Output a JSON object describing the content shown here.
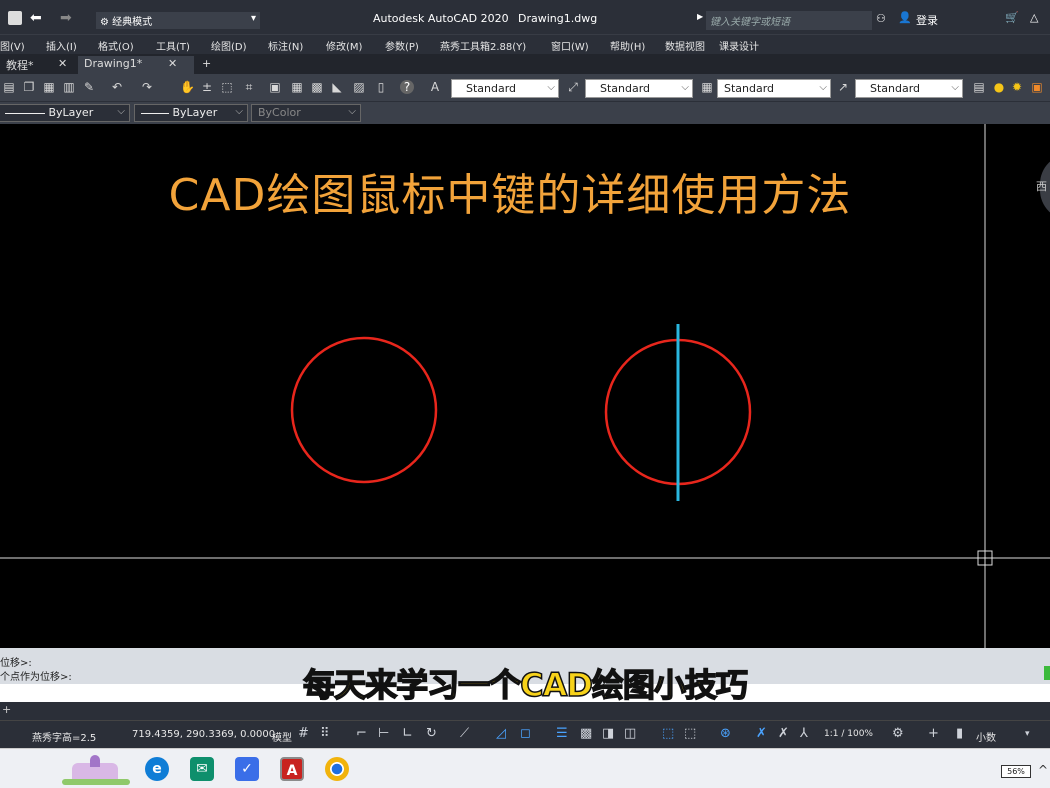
{
  "titlebar": {
    "workspace": "经典模式",
    "app_title": "Autodesk AutoCAD 2020",
    "file_name": "Drawing1.dwg",
    "search_placeholder": "键入关键字或短语",
    "login": "登录"
  },
  "menu": {
    "items": [
      "图(V)",
      "插入(I)",
      "格式(O)",
      "工具(T)",
      "绘图(D)",
      "标注(N)",
      "修改(M)",
      "参数(P)",
      "燕秀工具箱2.88(Y)",
      "窗口(W)",
      "帮助(H)",
      "数据视图",
      "课录设计"
    ]
  },
  "tabs": {
    "items": [
      "教程*",
      "Drawing1*"
    ],
    "close": "✕",
    "add": "+"
  },
  "toolbar": {
    "text_style": "Standard",
    "dim_style": "Standard",
    "table_style": "Standard",
    "mleader_style": "Standard",
    "linetype": "ByLayer",
    "lineweight": "ByLayer",
    "plot_style": "ByColor"
  },
  "drawing": {
    "title": "CAD绘图鼠标中键的详细使用方法",
    "viewcube_label": "西",
    "circle_color": "#e8261c",
    "line_color": "#2ab7e0",
    "title_color": "#f2a33a"
  },
  "command": {
    "line1": "位移>:",
    "line2": "个点作为位移>:"
  },
  "subtitle": "每天来学习一个CAD绘图小技巧",
  "status": {
    "text_height": "燕秀字高=2.5",
    "coordinates": "719.4359, 290.3369, 0.0000",
    "model": "模型",
    "scale": "1:1 / 100%",
    "units": "小数"
  },
  "taskbar": {
    "apps": [
      "edge-icon",
      "mail-icon",
      "teams-icon",
      "autocad-icon",
      "chrome-icon"
    ],
    "autocad_letter": "A",
    "battery": "56%"
  }
}
